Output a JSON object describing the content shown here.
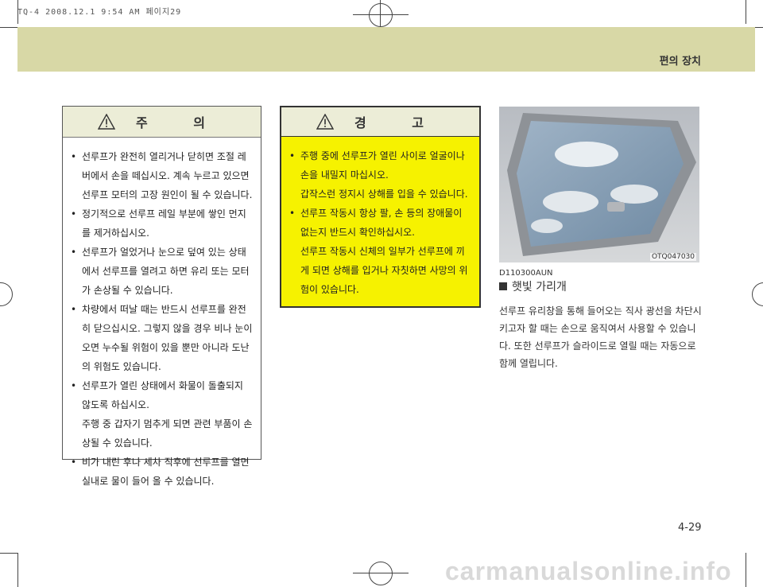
{
  "print_header": "TQ-4 2008.12.1 9:54 AM 페이지29",
  "header_title": "편의 장치",
  "caution": {
    "title": "주 의",
    "items": [
      {
        "lines": [
          "선루프가 완전히 열리거나 닫히면 조절 레버에서 손을 떼십시오. 계속 누르고 있으면 선루프 모터의 고장 원인이 될 수 있습니다."
        ]
      },
      {
        "lines": [
          "정기적으로 선루프 레일 부분에 쌓인 먼지를 제거하십시오."
        ]
      },
      {
        "lines": [
          "선루프가 얼었거나 눈으로 덮여 있는 상태에서 선루프를 열려고 하면 유리 또는 모터가 손상될 수 있습니다."
        ]
      },
      {
        "lines": [
          "차량에서 떠날 때는 반드시 선루프를 완전히 닫으십시오. 그렇지 않을 경우 비나 눈이 오면 누수될 위험이 있을 뿐만 아니라 도난의 위험도 있습니다."
        ]
      },
      {
        "lines": [
          "선루프가 열린 상태에서 화물이 돌출되지 않도록 하십시오.",
          "주행 중 갑자기 멈추게 되면 관련 부품이 손상될 수 있습니다."
        ]
      },
      {
        "lines": [
          "비가 내린 후나 세차 직후에 선루프를 열면 실내로 물이 들어 올 수 있습니다."
        ]
      }
    ]
  },
  "warning": {
    "title": "경 고",
    "items": [
      {
        "lines": [
          "주행 중에 선루프가 열린 사이로 얼굴이나 손을 내밀지 마십시오.",
          "갑작스런 정지시 상해를 입을 수 있습니다."
        ]
      },
      {
        "lines": [
          "선루프 작동시 항상 팔, 손 등의 장애물이 없는지 반드시 확인하십시오.",
          "선루프 작동시 신체의 일부가 선루프에 끼게 되면 상해를 입거나 자칫하면 사망의 위험이 있습니다."
        ]
      }
    ]
  },
  "photo_code": "OTQ047030",
  "section_code": "D110300AUN",
  "section_title": "햇빛 가리개",
  "section_body": "선루프 유리창을 통해 들어오는 직사 광선을 차단시키고자 할 때는 손으로 움직여서 사용할 수 있습니다. 또한 선루프가 슬라이드로 열릴 때는 자동으로 함께 열립니다.",
  "page_number": "4-29",
  "watermark": "carmanualsonline.info",
  "colors": {
    "header_band": "#d8d8a6",
    "warning_bg": "#f6f200",
    "box_head": "#ecedd7"
  }
}
